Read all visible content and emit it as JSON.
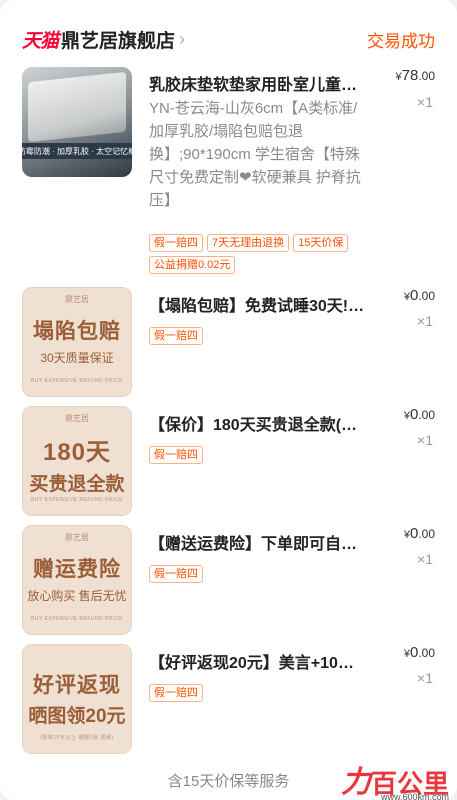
{
  "shop": {
    "platform": "天猫",
    "name": "鼎艺居旗舰店",
    "status": "交易成功"
  },
  "items": [
    {
      "title": "乳胶床垫软垫家用卧室儿童宿舍…",
      "spec": "YN-苍云海-山灰6cm【A类标准/加厚乳胶/塌陷包赔包退换】;90*190cm 学生宿舍【特殊尺寸免费定制❤软硬兼具 护脊抗压】",
      "price_cur": "¥",
      "price_int": "78",
      "price_dec": ".00",
      "qty": "×1",
      "tags": [
        "假一赔四",
        "7天无理由退换",
        "15天价保",
        "公益捐赠0.02元"
      ],
      "thumb_bar": "防霉防潮 · 加厚乳胶 · 太空记忆棉"
    },
    {
      "title": "【塌陷包赔】免费试睡30天!…",
      "price_cur": "¥",
      "price_int": "0",
      "price_dec": ".00",
      "qty": "×1",
      "tags": [
        "假一赔四"
      ],
      "thumb_logo": "鼎艺居",
      "thumb_line1": "塌陷包赔",
      "thumb_line2": "30天质量保证",
      "thumb_foot": "BUY EXPENSIVE REFUND PRICE"
    },
    {
      "title": "【保价】180天买贵退全款(…",
      "price_cur": "¥",
      "price_int": "0",
      "price_dec": ".00",
      "qty": "×1",
      "tags": [
        "假一赔四"
      ],
      "thumb_logo": "鼎艺居",
      "thumb_line1": "180天",
      "thumb_line2": "买贵退全款",
      "thumb_foot": "BUY EXPENSIVE REFUND PRICE"
    },
    {
      "title": "【赠送运费险】下单即可自动…",
      "price_cur": "¥",
      "price_int": "0",
      "price_dec": ".00",
      "qty": "×1",
      "tags": [
        "假一赔四"
      ],
      "thumb_logo": "鼎艺居",
      "thumb_line1": "赠运费险",
      "thumb_line2": "放心购买 售后无忧",
      "thumb_foot": "BUY EXPENSIVE REFUND PRICE"
    },
    {
      "title": "【好评返现20元】美言+10字…",
      "price_cur": "¥",
      "price_int": "0",
      "price_dec": ".00",
      "qty": "×1",
      "tags": [
        "假一赔四"
      ],
      "thumb_line1": "好评返现",
      "thumb_line2": "晒图领20元",
      "thumb_foot": "(限收15字以上·晒图3张·视频)"
    }
  ],
  "footer": {
    "text": "含15天价保等服务"
  },
  "watermark": {
    "text": "百公里",
    "url": "www.600km.com"
  },
  "colors": {
    "accent": "#ff5000",
    "brand": "#ff0036",
    "promo_bg": "#efe0d2",
    "promo_text": "#9b5e39"
  }
}
